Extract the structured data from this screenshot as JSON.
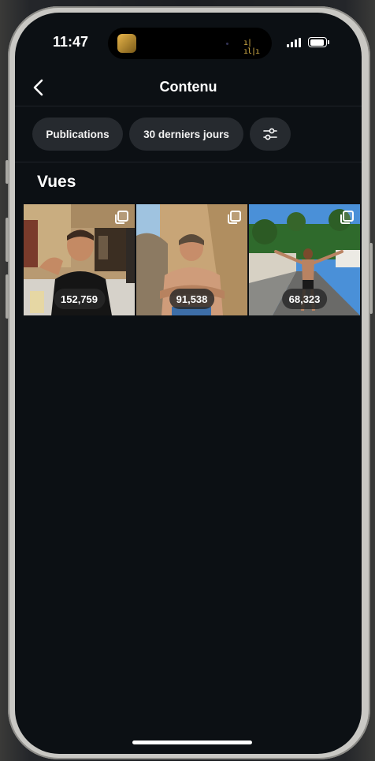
{
  "status_bar": {
    "time": "11:47"
  },
  "header": {
    "title": "Contenu",
    "back_icon": "chevron-left-icon"
  },
  "filters": {
    "chips": [
      {
        "label": "Publications"
      },
      {
        "label": "30 derniers jours"
      }
    ],
    "settings_icon": "sliders-icon"
  },
  "section": {
    "title": "Vues"
  },
  "posts": [
    {
      "views": "152,759",
      "type_icon": "carousel-icon"
    },
    {
      "views": "91,538",
      "type_icon": "carousel-icon"
    },
    {
      "views": "68,323",
      "type_icon": "carousel-icon"
    }
  ],
  "colors": {
    "background": "#0c1014",
    "chip": "#262a2f",
    "text": "#ffffff"
  }
}
